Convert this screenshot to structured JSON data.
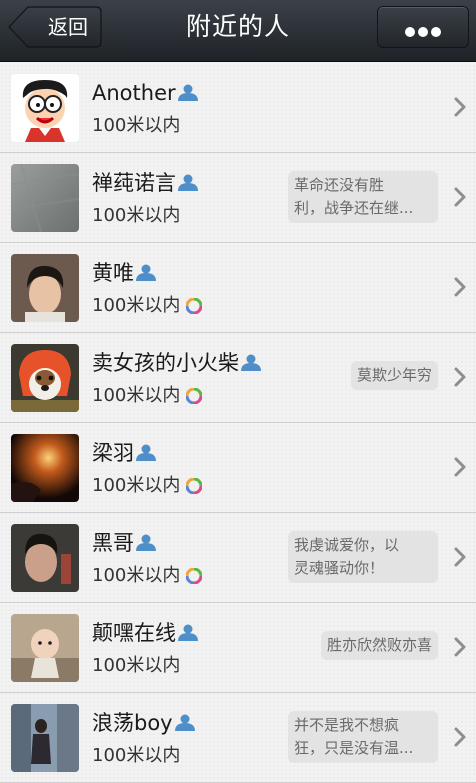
{
  "header": {
    "back_label": "返回",
    "title": "附近的人"
  },
  "people": [
    {
      "name": "Another",
      "distance": "100米以内",
      "signature": "",
      "has_moments": false
    },
    {
      "name": "禅莼诺言",
      "distance": "100米以内",
      "signature": "革命还没有胜\n利，战争还在继...",
      "has_moments": false
    },
    {
      "name": "黄唯",
      "distance": "100米以内",
      "signature": "",
      "has_moments": true
    },
    {
      "name": "卖女孩的小火柴",
      "distance": "100米以内",
      "signature": "莫欺少年穷",
      "has_moments": true
    },
    {
      "name": "梁羽",
      "distance": "100米以内",
      "signature": "",
      "has_moments": true
    },
    {
      "name": "黑哥",
      "distance": "100米以内",
      "signature": "我虔诚爱你，以\n灵魂骚动你！",
      "has_moments": true
    },
    {
      "name": "颠嘿在线",
      "distance": "100米以内",
      "signature": "胜亦欣然败亦喜",
      "has_moments": false
    },
    {
      "name": "浪荡boy",
      "distance": "100米以内",
      "signature": "并不是我不想疯\n狂，只是没有温...",
      "has_moments": false
    }
  ]
}
